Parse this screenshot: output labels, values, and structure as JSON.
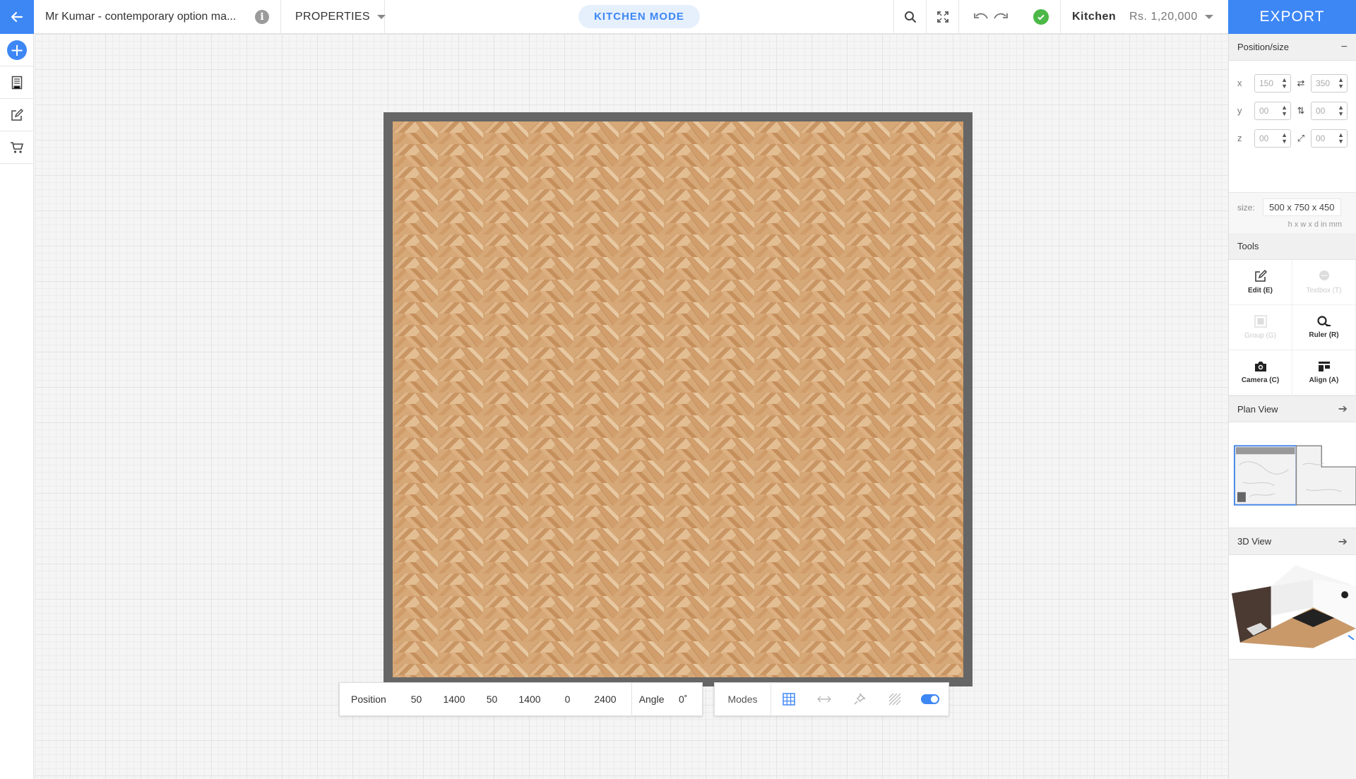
{
  "topbar": {
    "project_title": "Mr Kumar - contemporary option ma...",
    "properties_label": "PROPERTIES",
    "mode_label": "KITCHEN MODE",
    "room_label": "Kitchen",
    "price": "Rs. 1,20,000",
    "export_label": "EXPORT"
  },
  "leftrail": {
    "items": [
      "add-icon",
      "catalog-icon",
      "edit-icon",
      "cart-icon"
    ]
  },
  "position_bar": {
    "label": "Position",
    "values": [
      "50",
      "1400",
      "50",
      "1400",
      "0",
      "2400"
    ],
    "angle_label": "Angle",
    "angle_value": "0˚"
  },
  "modes_bar": {
    "label": "Modes"
  },
  "panel": {
    "position_size_title": "Position/size",
    "rows": [
      {
        "axis": "x",
        "a": "150",
        "b": "350"
      },
      {
        "axis": "y",
        "a": "00",
        "b": "00"
      },
      {
        "axis": "z",
        "a": "00",
        "b": "00"
      }
    ],
    "size_label": "size:",
    "size_value": "500 x 750 x 450",
    "size_unit": "h x w x d  in mm",
    "tools_title": "Tools",
    "tools": [
      {
        "label": "Edit (E)",
        "enabled": true
      },
      {
        "label": "Textbox (T)",
        "enabled": false
      },
      {
        "label": "Group (G)",
        "enabled": false
      },
      {
        "label": "Ruler (R)",
        "enabled": true
      },
      {
        "label": "Camera (C)",
        "enabled": true
      },
      {
        "label": "Align (A)",
        "enabled": true
      }
    ],
    "plan_view_title": "Plan View",
    "view3d_title": "3D View"
  },
  "colors": {
    "accent": "#3d87f5",
    "success": "#4cb848",
    "wall": "#666666",
    "floor": "#d5a676"
  }
}
